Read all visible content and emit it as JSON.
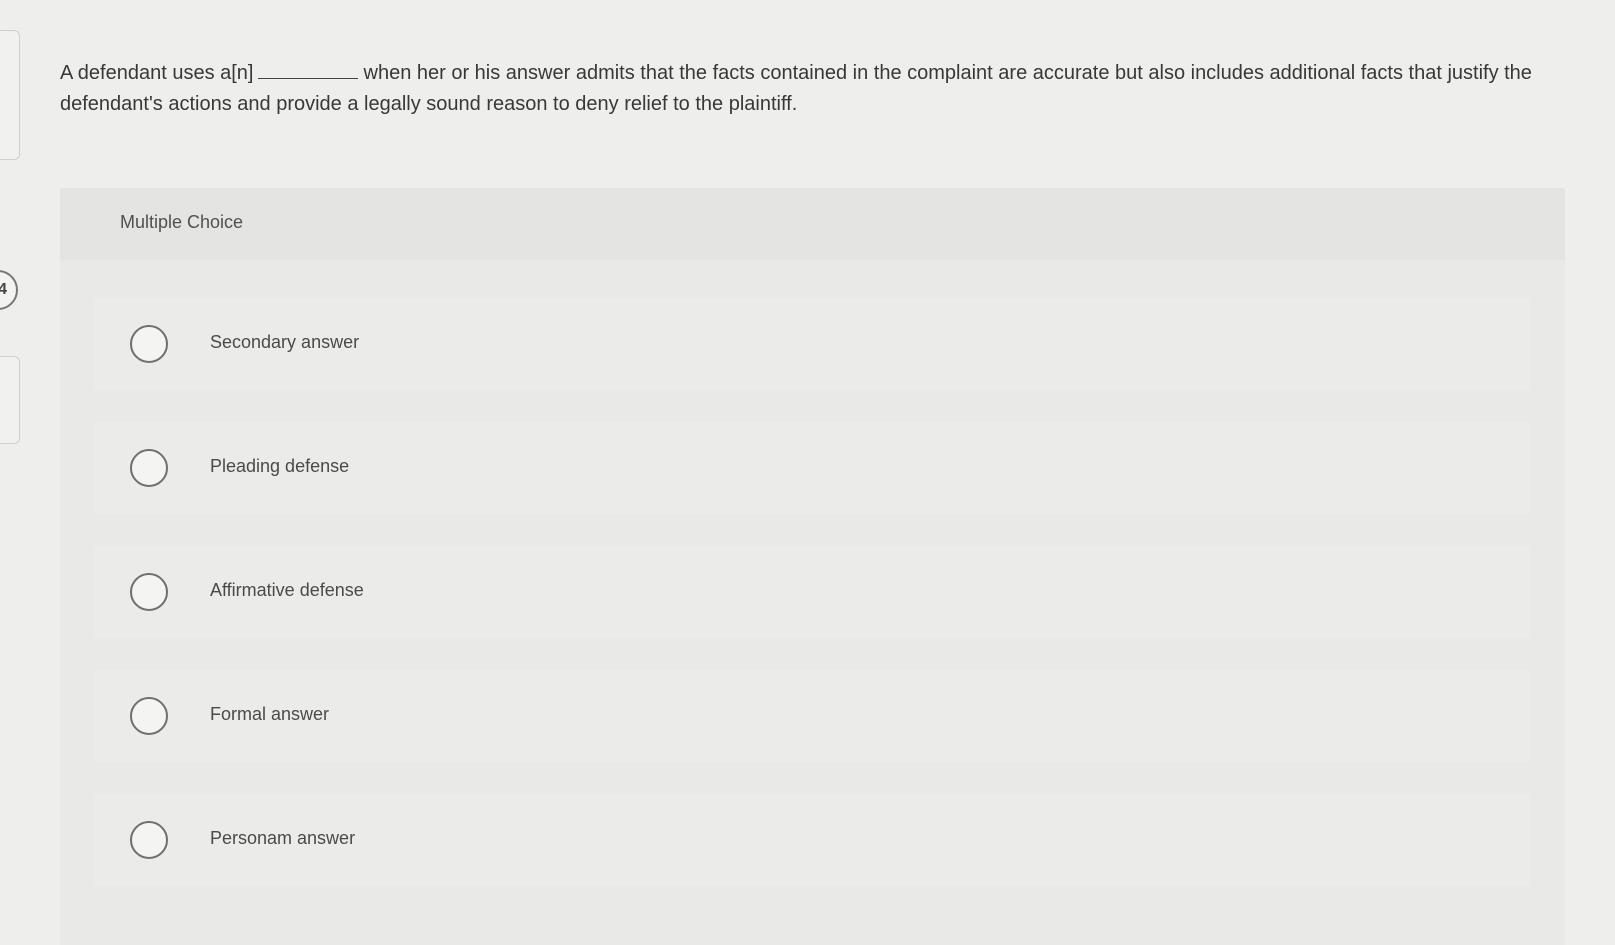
{
  "question": {
    "number": "4",
    "text_before_blank": "A defendant uses a[n]",
    "text_after_blank": "when her or his answer admits that the facts contained in the complaint are accurate but also includes additional facts that justify the defendant's actions and provide a legally sound reason to deny relief to the plaintiff."
  },
  "choices": {
    "header_label": "Multiple Choice",
    "options": [
      {
        "label": "Secondary answer"
      },
      {
        "label": "Pleading defense"
      },
      {
        "label": "Affirmative defense"
      },
      {
        "label": "Formal answer"
      },
      {
        "label": "Personam answer"
      }
    ]
  }
}
